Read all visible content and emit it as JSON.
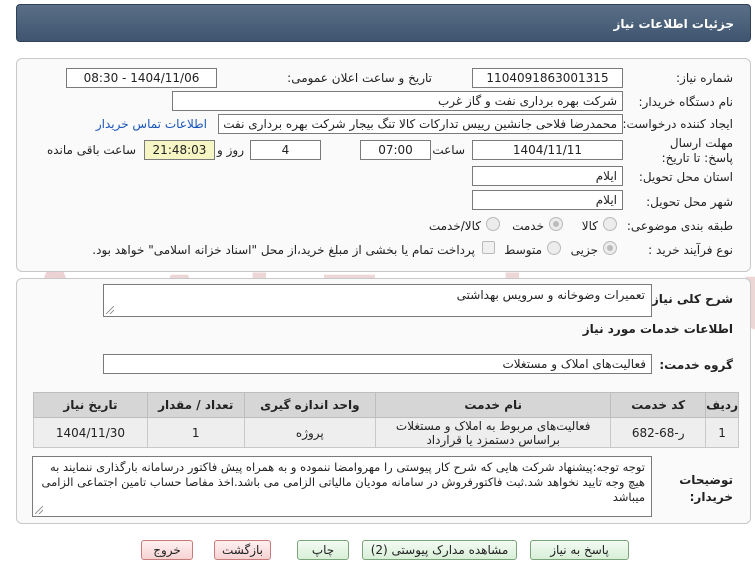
{
  "page_title": "جزئیات اطلاعات نیاز",
  "fields": {
    "need_number_label": "شماره نیاز:",
    "need_number": "1104091863001315",
    "announce_label": "تاریخ و ساعت اعلان عمومی:",
    "announce_value": "1404/11/06 - 08:30",
    "buyer_org_label": "نام دستگاه خریدار:",
    "buyer_org": "شرکت بهره برداری نفت و گاز غرب",
    "creator_label": "ایجاد کننده درخواست:",
    "creator": "محمدرضا فلاحی جانشین رییس تدارکات کالا تنگ بیجار شرکت بهره برداری نفت",
    "contact_link": "اطلاعات تماس خریدار",
    "deadline_label": "مهلت ارسال پاسخ: تا تاریخ:",
    "deadline_date": "1404/11/11",
    "hour_label": "ساعت",
    "deadline_time": "07:00",
    "days_count": "4",
    "days_label": "روز و",
    "remaining_time": "21:48:03",
    "remaining_label": "ساعت باقی مانده",
    "province_label": "استان محل تحویل:",
    "province": "ایلام",
    "city_label": "شهر محل تحویل:",
    "city": "ایلام",
    "category_label": "طبقه بندی موضوعی:",
    "category_options": [
      "کالا",
      "خدمت",
      "کالا/خدمت"
    ],
    "category_selected": "خدمت",
    "process_label": "نوع فرآیند خرید :",
    "process_options": [
      "جزیی",
      "متوسط"
    ],
    "payment_note": "پرداخت تمام یا بخشی از مبلغ خرید،از محل \"اسناد خزانه اسلامی\" خواهد بود."
  },
  "summary": {
    "label": "شرح کلی نیاز:",
    "value": "تعمیرات وضوخانه و سرویس بهداشتی"
  },
  "services": {
    "section_title": "اطلاعات خدمات مورد نیاز",
    "group_label": "گروه خدمت:",
    "group_value": "فعالیت‌های  املاک و مستغلات",
    "table": {
      "headers": [
        "ردیف",
        "کد خدمت",
        "نام خدمت",
        "واحد اندازه گیری",
        "تعداد / مقدار",
        "تاریخ نیاز"
      ],
      "rows": [
        [
          "1",
          "ر-68-682",
          "فعالیت‌های مربوط به املاک و مستغلات براساس دستمزد یا قرارداد",
          "پروژه",
          "1",
          "1404/11/30"
        ]
      ]
    }
  },
  "buyer_notes": {
    "label": "توضیحات خریدار:",
    "text": "توجه توجه:پیشنهاد شرکت هایی که شرح کار پیوستی را مهروامضا ننموده و به همراه پیش فاکتور درسامانه بارگذاری ننمایند به هیچ وجه تایید نخواهد شد.ثبت فاکتورفروش در سامانه مودیان مالیاتی الزامی می باشد.اخذ مفاصا حساب تامین اجتماعی الزامی میباشد"
  },
  "buttons": {
    "reply": "پاسخ به نیاز",
    "attachments": "مشاهده مدارک پیوستی (2)",
    "print": "چاپ",
    "back": "بازگشت",
    "exit": "خروج"
  },
  "watermark": "AriaTender.net",
  "colors": {
    "title_bar": "#4a5f78",
    "link": "#1a56b8",
    "remaining_bg": "#f6f6c4",
    "watermark": "#e7c9c9"
  }
}
